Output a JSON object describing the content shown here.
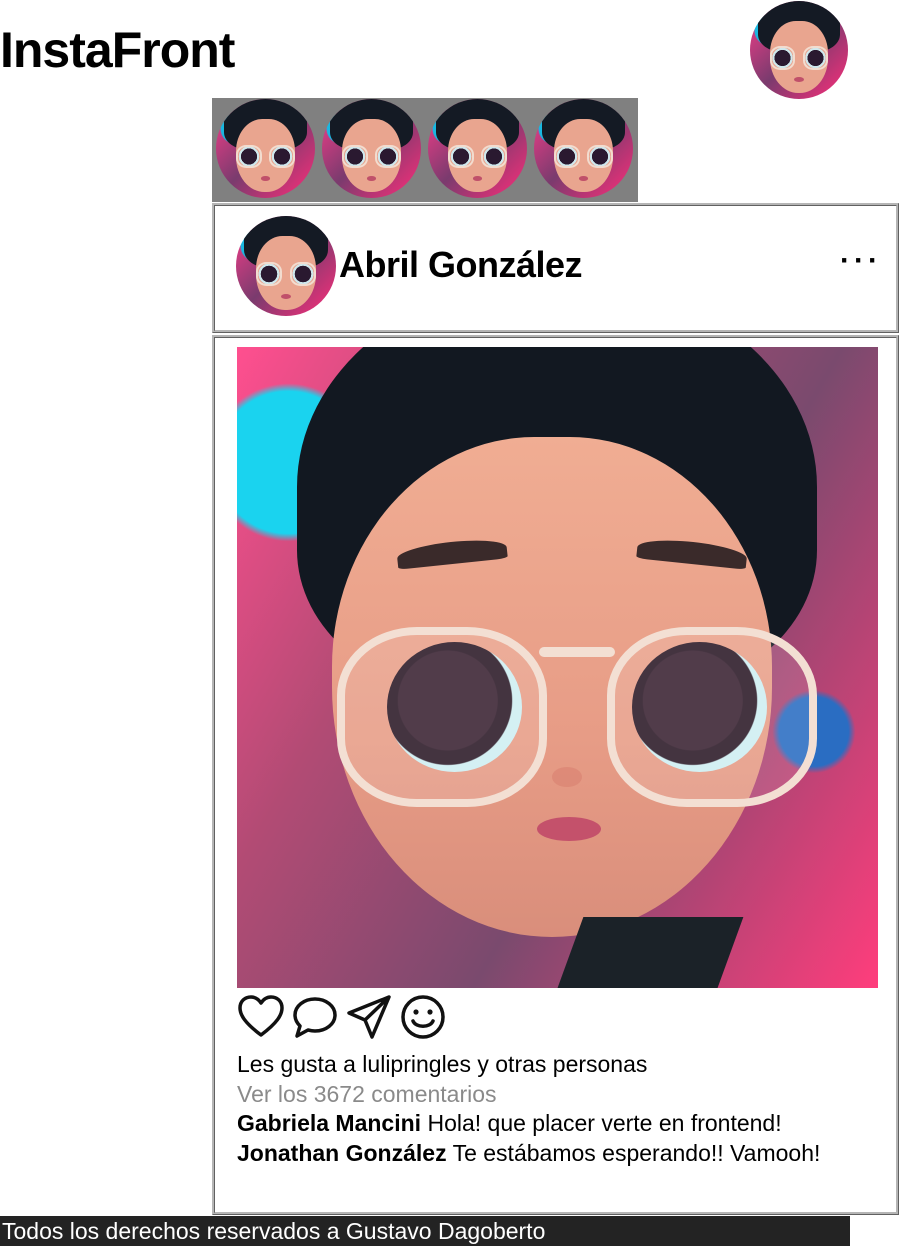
{
  "app": {
    "brand": "InstaFront"
  },
  "header": {
    "avatar_icon": "profile-avatar"
  },
  "stories": {
    "count": 4,
    "background": "#808080"
  },
  "post": {
    "author": "Abril González",
    "more_label": "···",
    "actions": [
      "heart-icon",
      "comment-icon",
      "send-icon",
      "smile-icon"
    ],
    "likes_text": "Les gusta a lulipringles y otras personas",
    "view_comments": "Ver los 3672 comentarios",
    "comments": [
      {
        "user": "Gabriela Mancini",
        "text": "Hola! que placer verte en frontend!"
      },
      {
        "user": "Jonathan González",
        "text": "Te estábamos esperando!! Vamooh!"
      }
    ]
  },
  "footer": {
    "text": "Todos los derechos reservados a Gustavo Dagoberto"
  },
  "colors": {
    "footer_bg": "#232323",
    "muted_text": "#8a8a8a",
    "stories_bg": "#808080"
  }
}
